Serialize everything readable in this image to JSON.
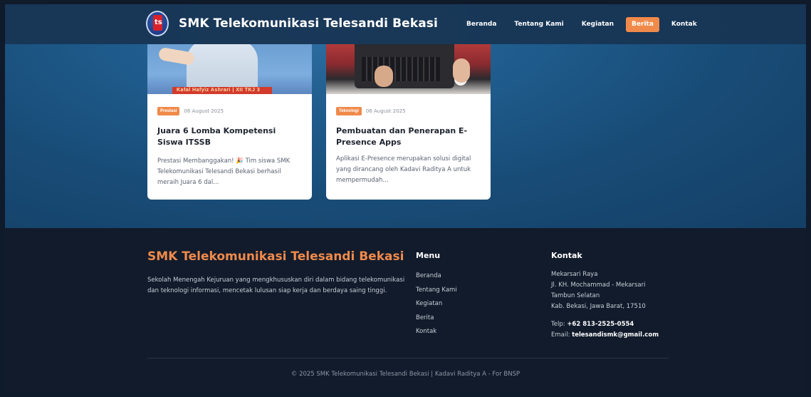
{
  "brand": {
    "title": "SMK Telekomunikasi Telesandi Bekasi"
  },
  "nav": {
    "items": [
      {
        "label": "Beranda"
      },
      {
        "label": "Tentang Kami"
      },
      {
        "label": "Kegiatan"
      },
      {
        "label": "Berita",
        "active": true
      },
      {
        "label": "Kontak"
      }
    ]
  },
  "cards": [
    {
      "image_banner": "Kafal Hafyiz Ashrari | XII TKJ 3",
      "tag": "Prestasi",
      "date": "06 August 2025",
      "title": "Juara 6 Lomba Kompetensi Siswa ITSSB",
      "excerpt": "Prestasi Membanggakan! 🎉 Tim siswa SMK Telekomunikasi Telesandi Bekasi berhasil meraih Juara 6 dal..."
    },
    {
      "tag": "Teknologi",
      "date": "06 August 2025",
      "title": "Pembuatan dan Penerapan E-Presence Apps",
      "excerpt": "Aplikasi E-Presence merupakan solusi digital yang dirancang oleh Kadavi Raditya A untuk mempermudah..."
    }
  ],
  "footer": {
    "brand": "SMK Telekomunikasi Telesandi Bekasi",
    "description": "Sekolah Menengah Kejuruan yang mengkhususkan diri dalam bidang telekomunikasi dan teknologi informasi, mencetak lulusan siap kerja dan berdaya saing tinggi.",
    "menu": {
      "heading": "Menu",
      "items": [
        "Beranda",
        "Tentang Kami",
        "Kegiatan",
        "Berita",
        "Kontak"
      ]
    },
    "contact": {
      "heading": "Kontak",
      "address": [
        "Mekarsari Raya",
        "Jl. KH. Mochammad - Mekarsari",
        "Tambun Selatan",
        "Kab. Bekasi, Jawa Barat, 17510"
      ],
      "phone_label": "Telp: ",
      "phone": "+62 813-2525-0554",
      "email_label": "Email: ",
      "email": "telesandismk@gmail.com"
    },
    "copyright": "© 2025 SMK Telekomunikasi Telesandi Bekasi | Kadavi Raditya A - For BNSP"
  },
  "colors": {
    "accent": "#f08a4b",
    "navbar": "#183452",
    "footer_bg": "#121b2b"
  }
}
